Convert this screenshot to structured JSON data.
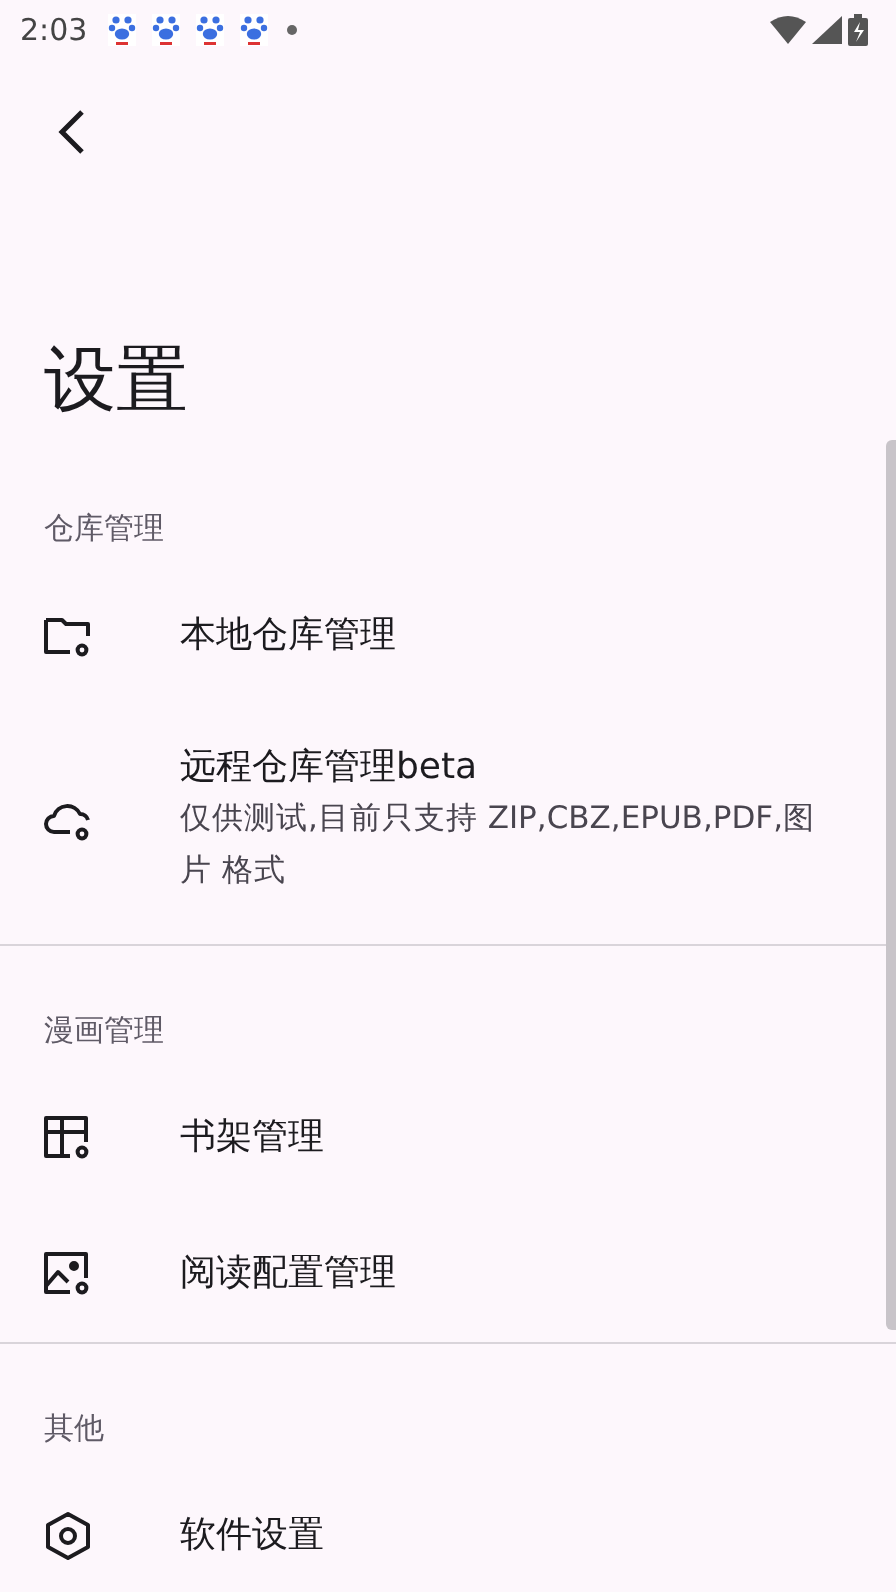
{
  "status_bar": {
    "time": "2:03"
  },
  "title": "设置",
  "sections": [
    {
      "header": "仓库管理",
      "items": [
        {
          "title": "本地仓库管理"
        },
        {
          "title": "远程仓库管理beta",
          "subtitle": "仅供测试,目前只支持 ZIP,CBZ,EPUB,PDF,图片 格式"
        }
      ]
    },
    {
      "header": "漫画管理",
      "items": [
        {
          "title": "书架管理"
        },
        {
          "title": "阅读配置管理"
        }
      ]
    },
    {
      "header": "其他",
      "items": [
        {
          "title": "软件设置"
        }
      ]
    }
  ]
}
